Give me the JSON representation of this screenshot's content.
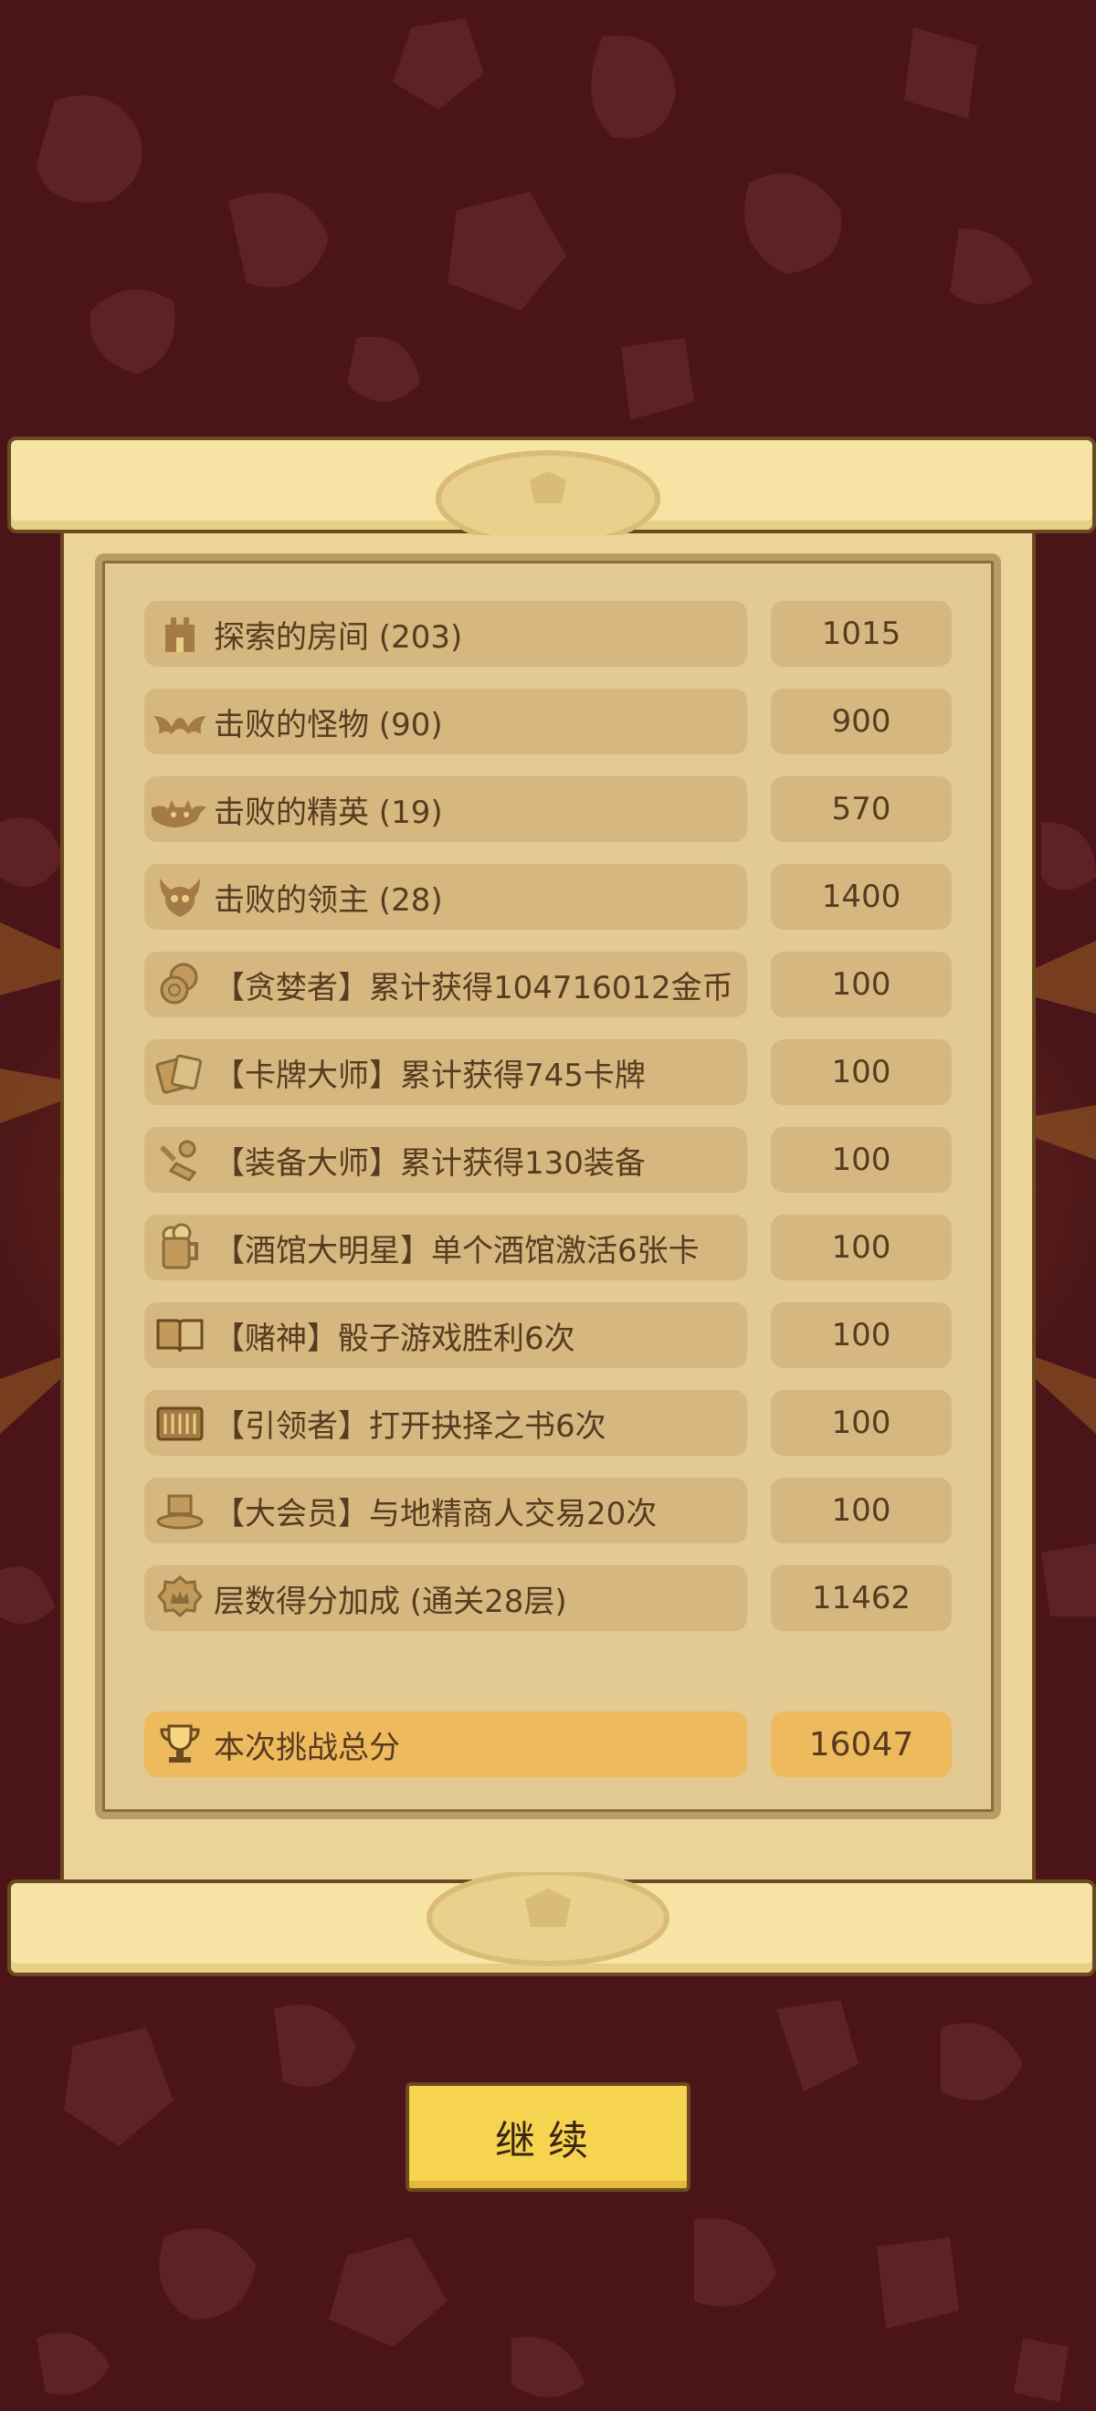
{
  "rows": [
    {
      "icon": "tower-icon",
      "label": "探索的房间 (203)",
      "value": "1015"
    },
    {
      "icon": "bat-icon",
      "label": "击败的怪物 (90)",
      "value": "900"
    },
    {
      "icon": "demon-icon",
      "label": "击败的精英 (19)",
      "value": "570"
    },
    {
      "icon": "skull-icon",
      "label": "击败的领主 (28)",
      "value": "1400"
    },
    {
      "icon": "coins-icon",
      "label": "【贪婪者】累计获得104716012金币",
      "value": "100"
    },
    {
      "icon": "cards-icon",
      "label": "【卡牌大师】累计获得745卡牌",
      "value": "100"
    },
    {
      "icon": "equipment-icon",
      "label": "【装备大师】累计获得130装备",
      "value": "100"
    },
    {
      "icon": "beer-mug-icon",
      "label": "【酒馆大明星】单个酒馆激活6张卡",
      "value": "100"
    },
    {
      "icon": "open-book-icon",
      "label": "【赌神】骰子游戏胜利6次",
      "value": "100"
    },
    {
      "icon": "book-icon",
      "label": "【引领者】打开抉择之书6次",
      "value": "100"
    },
    {
      "icon": "top-hat-icon",
      "label": "【大会员】与地精商人交易20次",
      "value": "100"
    },
    {
      "icon": "crown-badge-icon",
      "label": "层数得分加成 (通关28层)",
      "value": "11462"
    }
  ],
  "total": {
    "icon": "trophy-icon",
    "label": "本次挑战总分",
    "value": "16047"
  },
  "continue_label": "继续",
  "colors": {
    "background": "#4a1418",
    "parchment": "#ecd398",
    "row": "#d5b77f",
    "total_row": "#edbb5e",
    "button": "#f6d44f",
    "text": "#5a3a20"
  }
}
